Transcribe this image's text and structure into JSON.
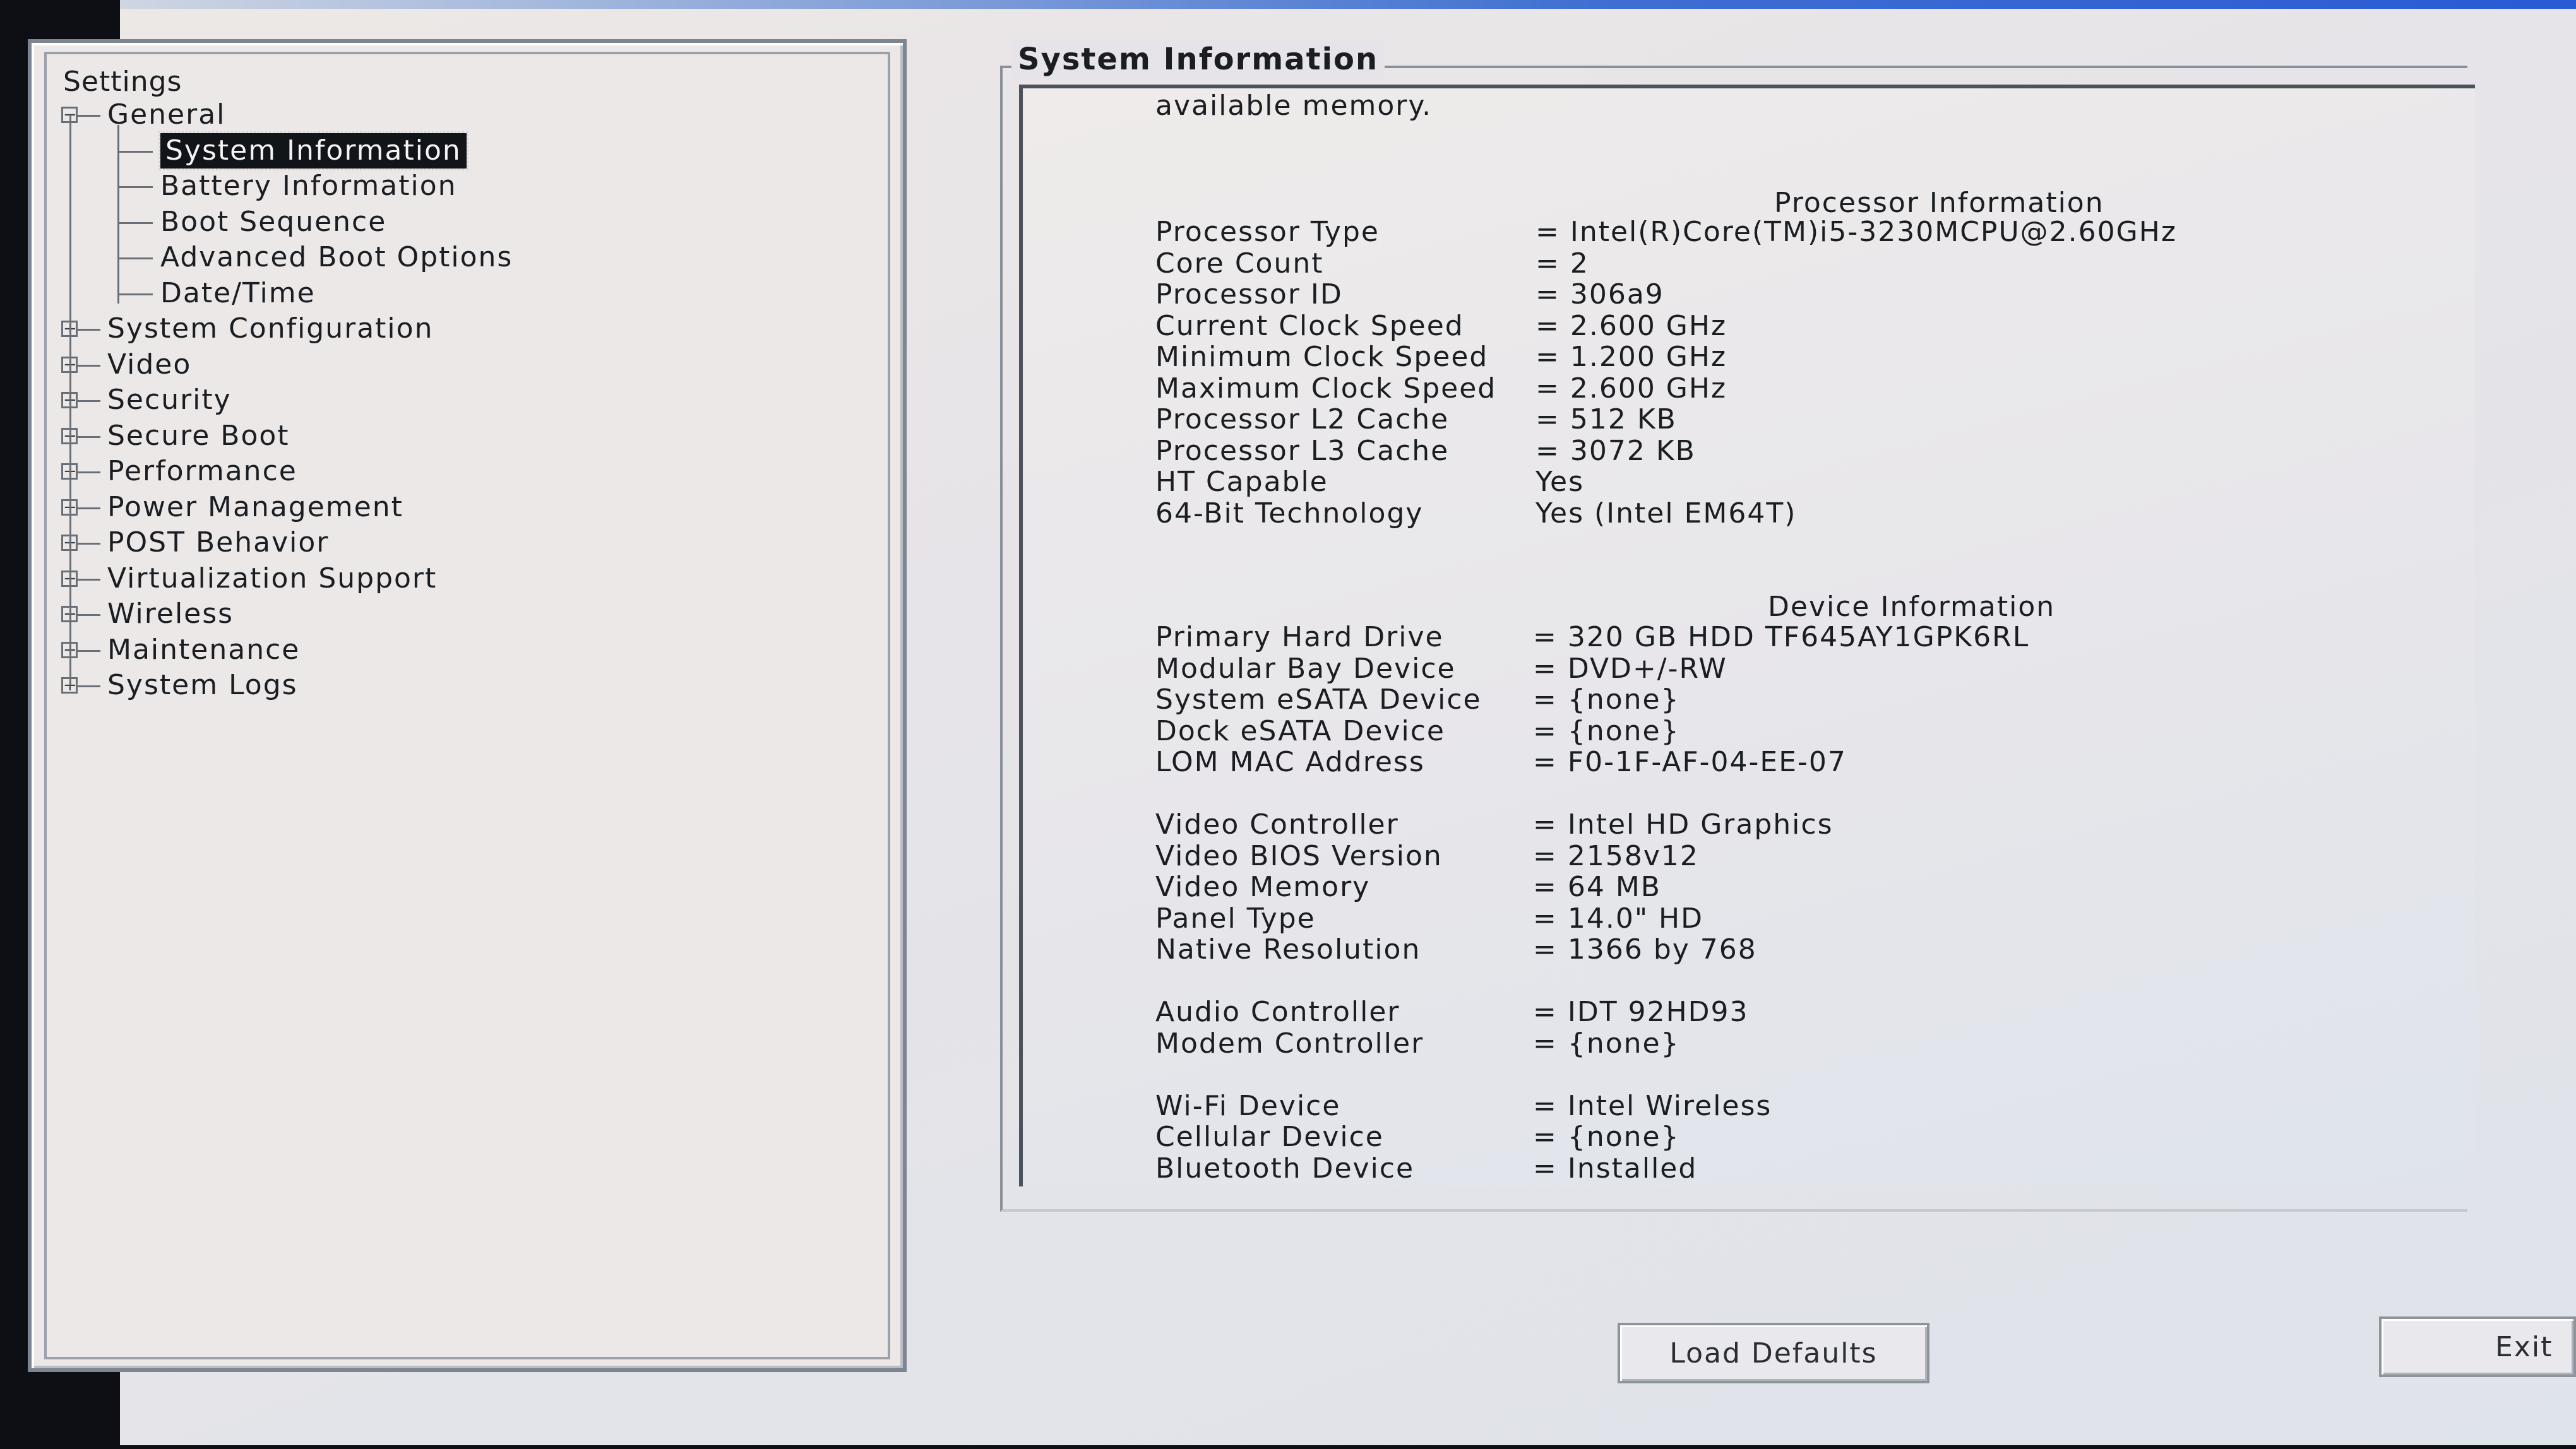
{
  "tree": {
    "root": "Settings",
    "items": [
      {
        "label": "General",
        "toggle": "−"
      },
      {
        "label": "System Information",
        "selected": true
      },
      {
        "label": "Battery Information"
      },
      {
        "label": "Boot Sequence"
      },
      {
        "label": "Advanced Boot Options"
      },
      {
        "label": "Date/Time"
      },
      {
        "label": "System Configuration",
        "toggle": "+"
      },
      {
        "label": "Video",
        "toggle": "+"
      },
      {
        "label": "Security",
        "toggle": "+"
      },
      {
        "label": "Secure Boot",
        "toggle": "+"
      },
      {
        "label": "Performance",
        "toggle": "+"
      },
      {
        "label": "Power Management",
        "toggle": "+"
      },
      {
        "label": "POST Behavior",
        "toggle": "+"
      },
      {
        "label": "Virtualization Support",
        "toggle": "+"
      },
      {
        "label": "Wireless",
        "toggle": "+"
      },
      {
        "label": "Maintenance",
        "toggle": "+"
      },
      {
        "label": "System Logs",
        "toggle": "+"
      }
    ]
  },
  "panel": {
    "title": "System Information",
    "intro": "available memory.",
    "processor_heading": "Processor Information",
    "device_heading": "Device Information",
    "processor_rows": [
      {
        "label": "Processor Type",
        "value": "= Intel(R)Core(TM)i5-3230MCPU@2.60GHz"
      },
      {
        "label": "Core Count",
        "value": "= 2"
      },
      {
        "label": "Processor ID",
        "value": "= 306a9"
      },
      {
        "label": "Current Clock Speed",
        "value": "= 2.600 GHz"
      },
      {
        "label": "Minimum Clock Speed",
        "value": "= 1.200 GHz"
      },
      {
        "label": "Maximum Clock Speed",
        "value": "= 2.600 GHz"
      },
      {
        "label": "Processor L2 Cache",
        "value": "= 512 KB"
      },
      {
        "label": "Processor L3 Cache",
        "value": "= 3072 KB"
      },
      {
        "label": "HT Capable",
        "value": "Yes"
      },
      {
        "label": "64-Bit Technology",
        "value": "Yes (Intel EM64T)"
      }
    ],
    "device_rows": [
      {
        "label": "Primary Hard Drive",
        "value": "= 320 GB HDD TF645AY1GPK6RL"
      },
      {
        "label": "Modular Bay Device",
        "value": "= DVD+/-RW"
      },
      {
        "label": "System eSATA Device",
        "value": "= {none}"
      },
      {
        "label": "Dock eSATA Device",
        "value": "= {none}"
      },
      {
        "label": "LOM MAC Address",
        "value": "= F0-1F-AF-04-EE-07"
      },
      {
        "label": "Video Controller",
        "value": "= Intel HD Graphics"
      },
      {
        "label": "Video BIOS Version",
        "value": "= 2158v12"
      },
      {
        "label": "Video Memory",
        "value": "= 64 MB"
      },
      {
        "label": "Panel Type",
        "value": "= 14.0\" HD"
      },
      {
        "label": "Native Resolution",
        "value": "= 1366 by 768"
      },
      {
        "label": "Audio Controller",
        "value": "= IDT 92HD93"
      },
      {
        "label": "Modem Controller",
        "value": "= {none}"
      },
      {
        "label": "Wi-Fi Device",
        "value": "= Intel Wireless"
      },
      {
        "label": "Cellular Device",
        "value": "= {none}"
      },
      {
        "label": "Bluetooth Device",
        "value": "= Installed"
      }
    ]
  },
  "buttons": {
    "load_defaults": "Load Defaults",
    "exit": "Exit"
  }
}
